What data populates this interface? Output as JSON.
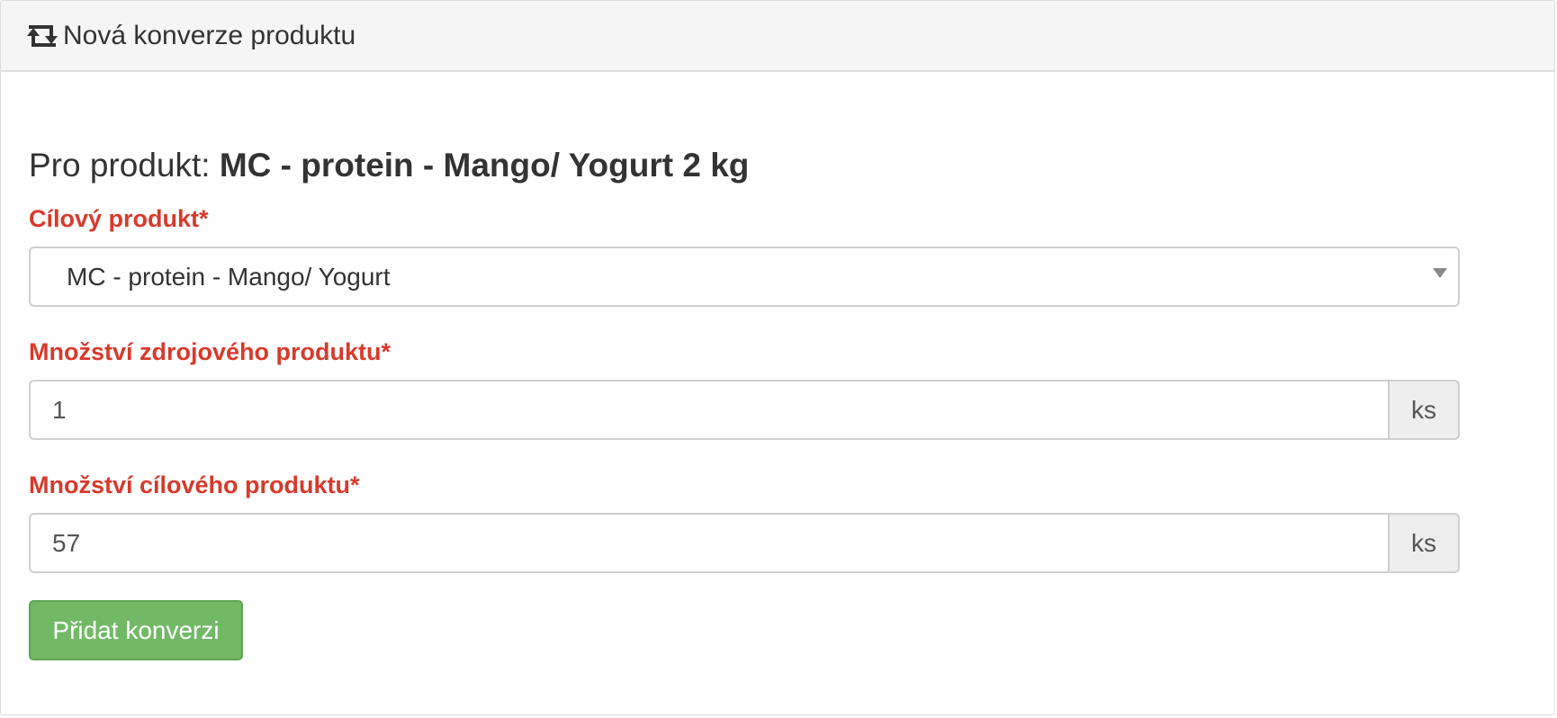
{
  "header": {
    "icon": "retweet-icon",
    "title": "Nová konverze produktu"
  },
  "product": {
    "prefix": "Pro produkt: ",
    "name": "MC - protein - Mango/ Yogurt 2 kg"
  },
  "target_product": {
    "label": "Cílový produkt*",
    "selected": "MC - protein - Mango/ Yogurt"
  },
  "source_quantity": {
    "label": "Množství zdrojového produktu*",
    "value": "1",
    "unit": "ks"
  },
  "target_quantity": {
    "label": "Množství cílového produktu*",
    "value": "57",
    "unit": "ks"
  },
  "submit": {
    "label": "Přidat konverzi"
  },
  "colors": {
    "label_required": "#d9392b",
    "button_success": "#72b966",
    "heading_bg": "#f5f5f5"
  }
}
